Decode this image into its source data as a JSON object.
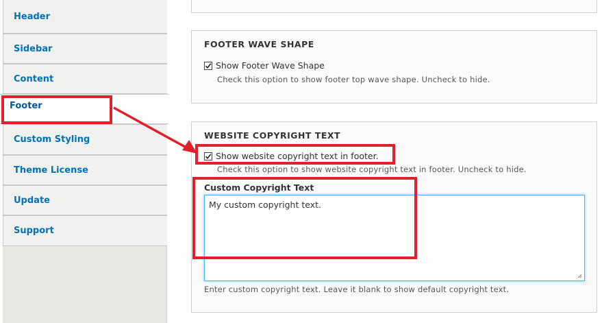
{
  "tabs": [
    {
      "label": "Header"
    },
    {
      "label": "Sidebar"
    },
    {
      "label": "Content"
    },
    {
      "label": "Footer"
    },
    {
      "label": "Custom Styling"
    },
    {
      "label": "Theme License"
    },
    {
      "label": "Update"
    },
    {
      "label": "Support"
    }
  ],
  "active_tab": "Footer",
  "footer_wave": {
    "legend": "FOOTER WAVE SHAPE",
    "checkbox_label": "Show Footer Wave Shape",
    "checked": true,
    "description": "Check this option to show footer top wave shape. Uncheck to hide."
  },
  "copyright": {
    "legend": "WEBSITE COPYRIGHT TEXT",
    "checkbox_label": "Show website copyright text in footer.",
    "checked": true,
    "description": "Check this option to show website copyright text in footer. Uncheck to hide.",
    "field_label": "Custom Copyright Text",
    "field_value": "My custom copyright text.",
    "field_help": "Enter custom copyright text. Leave it blank to show default copyright text."
  },
  "colors": {
    "tab_link": "#0072b9",
    "annotation": "#e0202a",
    "focus": "#40b3ff"
  }
}
